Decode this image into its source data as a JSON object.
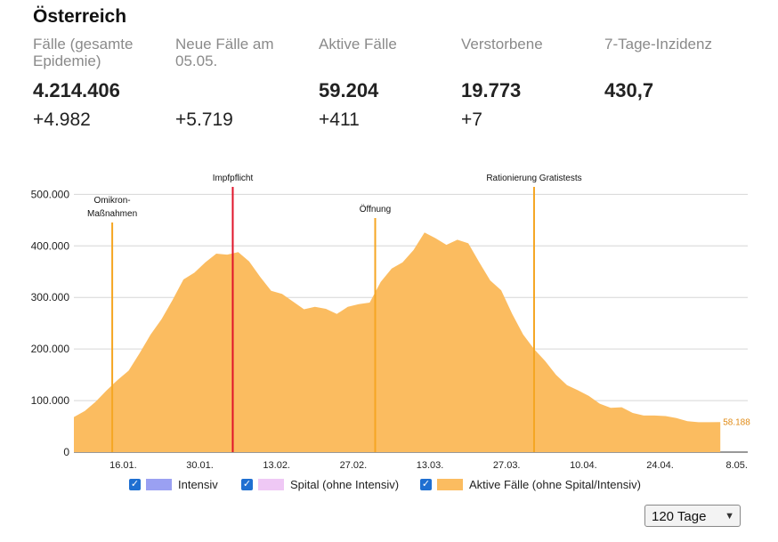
{
  "header": {
    "title": "Österreich"
  },
  "stats": [
    {
      "label": "Fälle (gesamte Epidemie)",
      "value": "4.214.406",
      "change": "+4.982"
    },
    {
      "label": "Neue Fälle am 05.05.",
      "value": "",
      "change": "+5.719"
    },
    {
      "label": "Aktive Fälle",
      "value": "59.204",
      "change": "+411"
    },
    {
      "label": "Verstorbene",
      "value": "19.773",
      "change": "+7"
    },
    {
      "label": "7-Tage-Inzidenz",
      "value": "430,7",
      "change": ""
    }
  ],
  "colors": {
    "active": "#fbbc60",
    "intensiv": "#9aa0f2",
    "spital": "#efc8f5",
    "marker": "#f5a623",
    "impfpflicht": "#e0142a",
    "checkbox": "#1f6fd1"
  },
  "chart_data": {
    "type": "area",
    "y_ticks": [
      {
        "value": 0,
        "label": "0"
      },
      {
        "value": 100000,
        "label": "100.000"
      },
      {
        "value": 200000,
        "label": "200.000"
      },
      {
        "value": 300000,
        "label": "300.000"
      },
      {
        "value": 400000,
        "label": "400.000"
      },
      {
        "value": 500000,
        "label": "500.000"
      }
    ],
    "ylim": [
      0,
      530000
    ],
    "x_range": [
      "2022-01-07",
      "2022-05-10"
    ],
    "x_ticks": [
      {
        "date": "2022-01-16",
        "label": "16.01."
      },
      {
        "date": "2022-01-30",
        "label": "30.01."
      },
      {
        "date": "2022-02-13",
        "label": "13.02."
      },
      {
        "date": "2022-02-27",
        "label": "27.02."
      },
      {
        "date": "2022-03-13",
        "label": "13.03."
      },
      {
        "date": "2022-03-27",
        "label": "27.03."
      },
      {
        "date": "2022-04-10",
        "label": "10.04."
      },
      {
        "date": "2022-04-24",
        "label": "24.04."
      },
      {
        "date": "2022-05-08",
        "label": "8.05."
      }
    ],
    "grid": true,
    "series": [
      {
        "name": "Aktive Fälle (ohne Spital/Intensiv)",
        "x": [
          "2022-01-07",
          "2022-01-09",
          "2022-01-11",
          "2022-01-13",
          "2022-01-15",
          "2022-01-17",
          "2022-01-19",
          "2022-01-21",
          "2022-01-23",
          "2022-01-25",
          "2022-01-27",
          "2022-01-29",
          "2022-01-31",
          "2022-02-02",
          "2022-02-04",
          "2022-02-06",
          "2022-02-08",
          "2022-02-10",
          "2022-02-12",
          "2022-02-14",
          "2022-02-16",
          "2022-02-18",
          "2022-02-20",
          "2022-02-22",
          "2022-02-24",
          "2022-02-26",
          "2022-02-28",
          "2022-03-02",
          "2022-03-04",
          "2022-03-06",
          "2022-03-08",
          "2022-03-10",
          "2022-03-12",
          "2022-03-14",
          "2022-03-16",
          "2022-03-18",
          "2022-03-20",
          "2022-03-22",
          "2022-03-24",
          "2022-03-26",
          "2022-03-28",
          "2022-03-30",
          "2022-04-01",
          "2022-04-03",
          "2022-04-05",
          "2022-04-07",
          "2022-04-09",
          "2022-04-11",
          "2022-04-13",
          "2022-04-15",
          "2022-04-17",
          "2022-04-19",
          "2022-04-21",
          "2022-04-23",
          "2022-04-25",
          "2022-04-27",
          "2022-04-29",
          "2022-05-01",
          "2022-05-03",
          "2022-05-05"
        ],
        "values": [
          68000,
          80000,
          98000,
          120000,
          140000,
          158000,
          192000,
          228000,
          258000,
          295000,
          335000,
          348000,
          368000,
          385000,
          383000,
          388000,
          370000,
          340000,
          313000,
          307000,
          292000,
          277000,
          282000,
          278000,
          268000,
          282000,
          287000,
          290000,
          330000,
          356000,
          368000,
          392000,
          426000,
          415000,
          402000,
          412000,
          405000,
          368000,
          333000,
          314000,
          268000,
          228000,
          200000,
          177000,
          150000,
          130000,
          120000,
          109000,
          94000,
          86000,
          87000,
          76000,
          71000,
          71000,
          70000,
          66000,
          60000,
          58000,
          58000,
          58188
        ]
      },
      {
        "name": "Spital (ohne Intensiv)",
        "values": []
      },
      {
        "name": "Intensiv",
        "values": []
      }
    ],
    "end_label": "58.188",
    "annotations": [
      {
        "date": "2022-01-14",
        "label": "Omikron-\nMaßnahmen",
        "color": "marker"
      },
      {
        "date": "2022-02-05",
        "label": "Impfpflicht",
        "color": "impfpflicht"
      },
      {
        "date": "2022-03-03",
        "label": "Öffnung",
        "color": "marker"
      },
      {
        "date": "2022-04-01",
        "label": "Rationierung Gratistests",
        "color": "marker"
      }
    ]
  },
  "legend": [
    {
      "label": "Intensiv",
      "checked": true,
      "color": "intensiv"
    },
    {
      "label": "Spital (ohne Intensiv)",
      "checked": true,
      "color": "spital"
    },
    {
      "label": "Aktive Fälle (ohne Spital/Intensiv)",
      "checked": true,
      "color": "active"
    }
  ],
  "range_select": {
    "value": "120 Tage"
  }
}
